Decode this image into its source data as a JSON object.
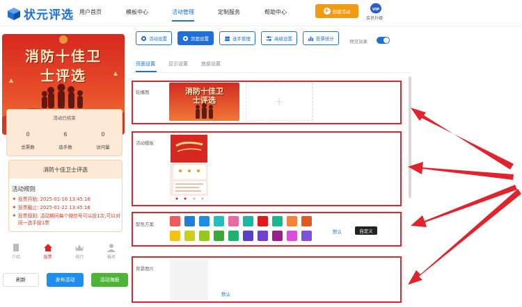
{
  "brand": {
    "name": "状元评选"
  },
  "nav": {
    "home": "用户首页",
    "templates": "模板中心",
    "activity": "活动管理",
    "custom": "定制服务",
    "help": "帮助中心"
  },
  "header": {
    "create_label": "创建活动",
    "vip_badge": "VIP",
    "upgrade_label": "会员升级"
  },
  "preview": {
    "poster_line1": "消防十佳卫",
    "poster_line2": "士评选",
    "status": "活动已结束",
    "stats": [
      {
        "value": "0",
        "label": "总票数"
      },
      {
        "value": "6",
        "label": "选手数"
      },
      {
        "value": "0",
        "label": "访问量"
      }
    ],
    "activity_name": "消防十佳卫士评选",
    "rules_title": "活动规则",
    "rules": [
      "投票开始:  2025-01-16 13:45:16",
      "投票截止:  2025-01-22 13:45:16",
      "投票规则:  活动期间每个微信号可以投1次,可以对同一选手投1票"
    ],
    "bottom_nav": [
      "介绍",
      "投票",
      "排行",
      "报名"
    ]
  },
  "left_buttons": {
    "refresh": "刷新",
    "publish": "发布活动",
    "poster": "活动海报"
  },
  "tabs": [
    "活动设置",
    "页面设置",
    "选手管理",
    "高级设置",
    "投票统计"
  ],
  "preview_toggle_label": "预览效果",
  "subtabs": [
    "页面设置",
    "显示设置",
    "底部设置"
  ],
  "sections": {
    "carousel": "轮播图",
    "template": "活动模板",
    "color": "配色方案",
    "bg": "背景图片"
  },
  "color_scheme": {
    "default_label": "默认",
    "custom_label": "自定义",
    "row1": [
      "#f05a5a",
      "#1f7ed6",
      "#1b8fe0",
      "#20c0c0",
      "#e86aa0",
      "#1ab8a0",
      "#e01818",
      "#18b890",
      "#f5833a",
      "#e05a20"
    ],
    "row2": [
      "#f2c418",
      "#c8d018",
      "#98c820",
      "#3aa838",
      "#20b070",
      "#5a40c8",
      "#7040d0",
      "#9a2090",
      "#d850d8",
      "#8050d8"
    ]
  },
  "bg_default_label": "默认",
  "colors": {
    "primary": "#1e6fd9",
    "orange": "#f39a13",
    "highlight_red": "#e0242e",
    "publish_blue": "#1e8ff0",
    "poster_green": "#4cb536"
  }
}
